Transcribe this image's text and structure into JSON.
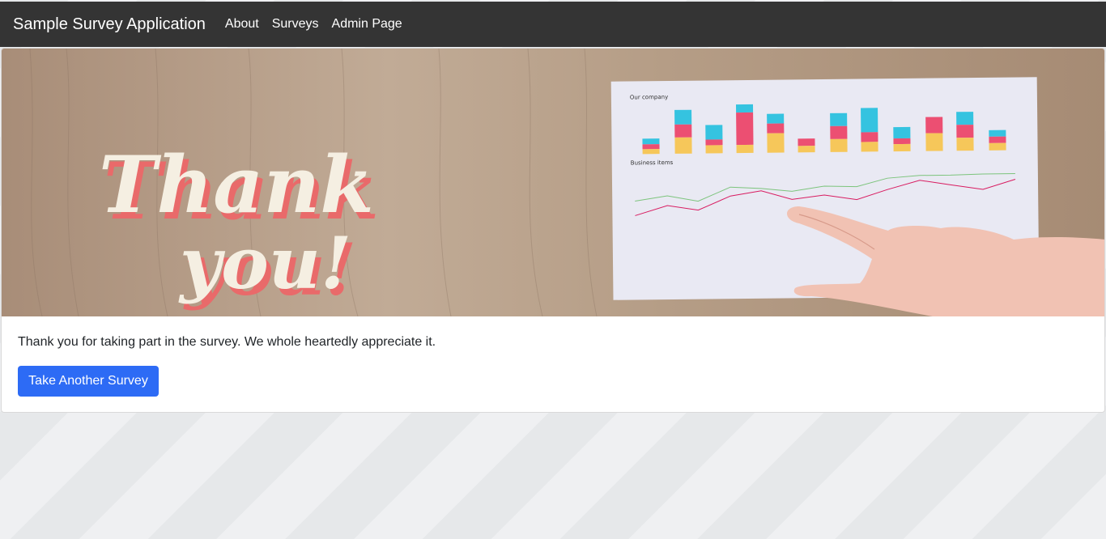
{
  "navbar": {
    "brand": "Sample Survey Application",
    "links": [
      {
        "label": "About"
      },
      {
        "label": "Surveys"
      },
      {
        "label": "Admin Page"
      }
    ]
  },
  "hero": {
    "image_text_line1": "Thank",
    "image_text_line2": "you!",
    "paper_title": "Our company",
    "paper_subtitle": "Business items"
  },
  "content": {
    "message": "Thank you for taking part in the survey. We whole heartedly appreciate it.",
    "button_label": "Take Another Survey"
  },
  "colors": {
    "navbar_bg": "#343434",
    "button_bg": "#2d6bf5",
    "bar_cyan": "#35c3e0",
    "bar_pink": "#ec4f72",
    "bar_yellow": "#f6c75a"
  }
}
